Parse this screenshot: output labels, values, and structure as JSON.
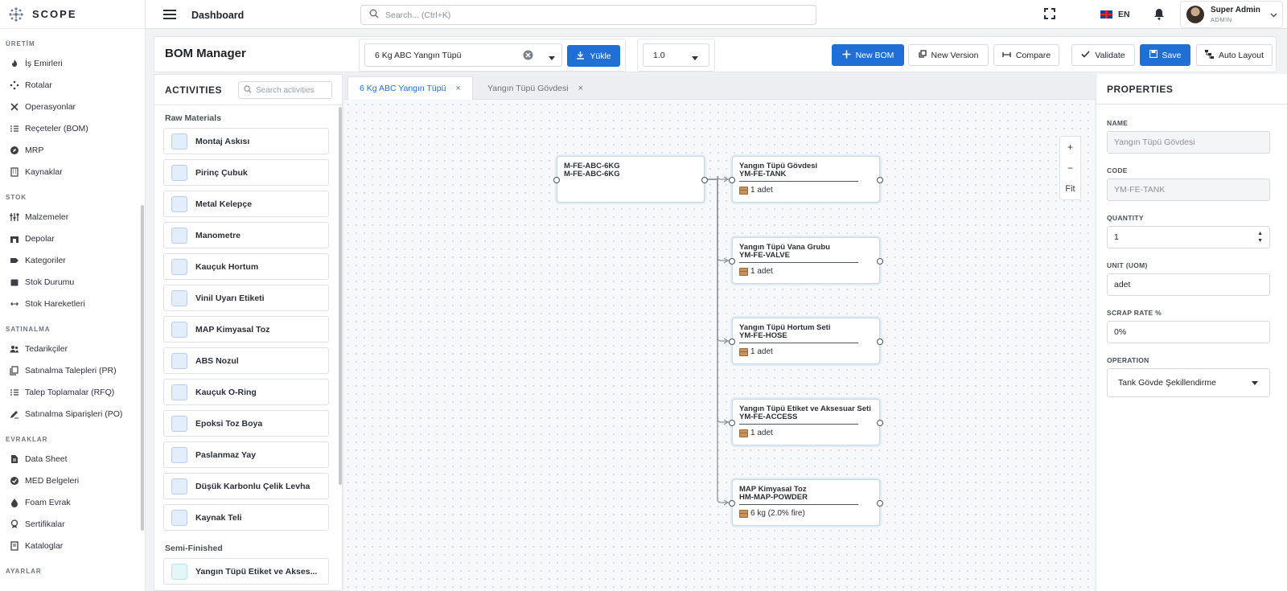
{
  "app": {
    "name": "SCOPE"
  },
  "topbar": {
    "page_title": "Dashboard",
    "search_placeholder": "Search... (Ctrl+K)",
    "language": "EN",
    "user_name": "Super Admin",
    "user_role": "ADMIN"
  },
  "sidebar": {
    "sections": [
      {
        "title": "ÜRETİM",
        "items": [
          {
            "label": "İş Emirleri",
            "icon": "flame-icon"
          },
          {
            "label": "Rotalar",
            "icon": "route-icon"
          },
          {
            "label": "Operasyonlar",
            "icon": "tools-icon"
          },
          {
            "label": "Reçeteler (BOM)",
            "icon": "list-icon"
          },
          {
            "label": "MRP",
            "icon": "compass-icon"
          },
          {
            "label": "Kaynaklar",
            "icon": "building-icon"
          }
        ]
      },
      {
        "title": "STOK",
        "items": [
          {
            "label": "Malzemeler",
            "icon": "sliders-icon"
          },
          {
            "label": "Depolar",
            "icon": "warehouse-icon"
          },
          {
            "label": "Kategoriler",
            "icon": "tag-icon"
          },
          {
            "label": "Stok Durumu",
            "icon": "box-icon"
          },
          {
            "label": "Stok Hareketleri",
            "icon": "transfer-icon"
          }
        ]
      },
      {
        "title": "SATINALMA",
        "items": [
          {
            "label": "Tedarikçiler",
            "icon": "users-icon"
          },
          {
            "label": "Satınalma Talepleri (PR)",
            "icon": "copy-icon"
          },
          {
            "label": "Talep Toplamalar (RFQ)",
            "icon": "list-icon"
          },
          {
            "label": "Satınalma Siparişleri (PO)",
            "icon": "pen-icon"
          }
        ]
      },
      {
        "title": "EVRAKLAR",
        "items": [
          {
            "label": "Data Sheet",
            "icon": "file-icon"
          },
          {
            "label": "MED Belgeleri",
            "icon": "check-badge-icon"
          },
          {
            "label": "Foam Evrak",
            "icon": "drop-icon"
          },
          {
            "label": "Sertifikalar",
            "icon": "award-icon"
          },
          {
            "label": "Kataloglar",
            "icon": "book-icon"
          }
        ]
      },
      {
        "title": "AYARLAR",
        "items": []
      }
    ]
  },
  "header": {
    "title": "BOM Manager",
    "product_select": "6 Kg ABC Yangın Tüpü",
    "load_button": "Yükle",
    "version_select": "1.0",
    "buttons": {
      "new_bom": "New BOM",
      "new_version": "New Version",
      "compare": "Compare",
      "validate": "Validate",
      "save": "Save",
      "auto_layout": "Auto Layout"
    }
  },
  "activities": {
    "title": "ACTIVITIES",
    "search_placeholder": "Search activities",
    "raw_label": "Raw Materials",
    "raw_items": [
      "Montaj Askısı",
      "Pirinç Çubuk",
      "Metal Kelepçe",
      "Manometre",
      "Kauçuk Hortum",
      "Vinil Uyarı Etiketi",
      "MAP Kimyasal Toz",
      "ABS Nozul",
      "Kauçuk O-Ring",
      "Epoksi Toz Boya",
      "Paslanmaz Yay",
      "Düşük Karbonlu Çelik Levha",
      "Kaynak Teli"
    ],
    "semi_label": "Semi-Finished",
    "semi_items": [
      "Yangın Tüpü Etiket ve Akses..."
    ]
  },
  "canvas": {
    "tabs": [
      {
        "label": "6 Kg ABC Yangın Tüpü",
        "active": true
      },
      {
        "label": "Yangın Tüpü Gövdesi",
        "active": false
      }
    ],
    "zoom": {
      "in": "+",
      "out": "−",
      "fit": "Fit"
    },
    "root": {
      "line1": "M-FE-ABC-6KG",
      "line2": "M-FE-ABC-6KG"
    },
    "children": [
      {
        "name": "Yangın Tüpü Gövdesi",
        "code": "YM-FE-TANK",
        "qty": "1 adet"
      },
      {
        "name": "Yangın Tüpü Vana Grubu",
        "code": "YM-FE-VALVE",
        "qty": "1 adet"
      },
      {
        "name": "Yangın Tüpü Hortum Seti",
        "code": "YM-FE-HOSE",
        "qty": "1 adet"
      },
      {
        "name": "Yangın Tüpü Etiket ve Aksesuar Seti",
        "code": "YM-FE-ACCESS",
        "qty": "1 adet"
      },
      {
        "name": "MAP Kimyasal Toz",
        "code": "HM-MAP-POWDER",
        "qty": "6 kg (2.0% fire)"
      }
    ]
  },
  "properties": {
    "title": "PROPERTIES",
    "name_label": "NAME",
    "name_value": "Yangın Tüpü Gövdesi",
    "code_label": "CODE",
    "code_value": "YM-FE-TANK",
    "quantity_label": "QUANTITY",
    "quantity_value": "1",
    "unit_label": "UNIT (UOM)",
    "unit_value": "adet",
    "scrap_label": "SCRAP RATE %",
    "scrap_value": "0%",
    "operation_label": "OPERATION",
    "operation_value": "Tank Gövde Şekillendirme"
  },
  "colors": {
    "primary": "#1f6fd6",
    "node_border": "#c9d7e8"
  }
}
